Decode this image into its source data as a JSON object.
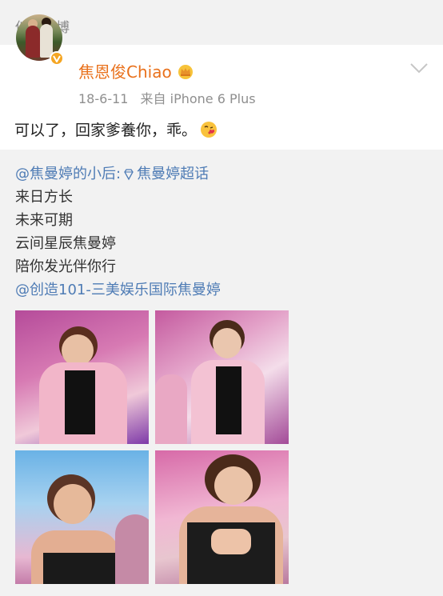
{
  "section": {
    "title": "他的微博"
  },
  "post": {
    "username": "焦恩俊Chiao",
    "date": "18-6-11",
    "source": "来自 iPhone 6 Plus",
    "text": "可以了，回家爹養你，乖。"
  },
  "repost": {
    "mention": "@焦曼婷的小后",
    "separator": " :",
    "topic": "焦曼婷超话",
    "lines": [
      "来日方长",
      "未来可期",
      "云间星辰焦曼婷",
      "陪你发光伴你行"
    ],
    "footer_mention": "@创造101-三美娱乐国际焦曼婷"
  },
  "icons": {
    "avatar": "avatar-photo",
    "verified": "verified-badge-icon",
    "crown": "crown-icon",
    "chevron": "chevron-down-icon",
    "emoji": "kiss-emoji-icon",
    "gem": "diamond-icon"
  },
  "colors": {
    "username": "#e9711c",
    "link": "#4f7cb5",
    "muted": "#8f8f8f",
    "background": "#f2f2f2"
  }
}
